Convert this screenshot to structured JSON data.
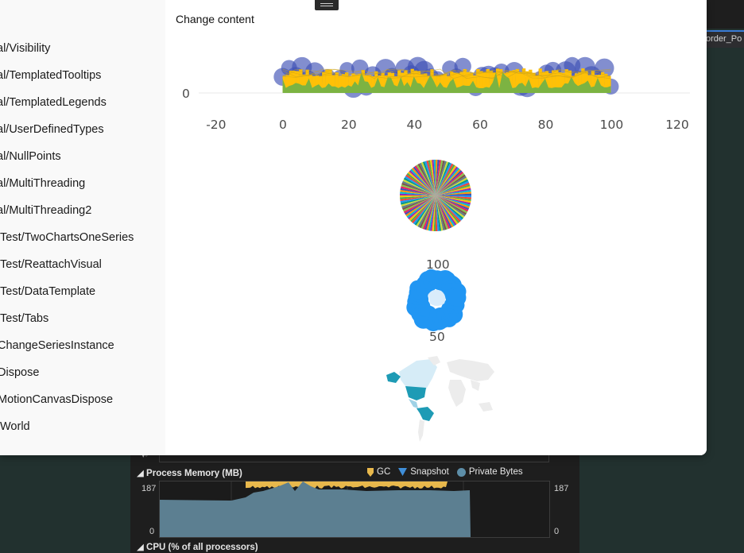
{
  "ide": {
    "tab_label": "order_Po"
  },
  "diagnostics": {
    "memory_heading": "Process Memory (MB)",
    "legend": {
      "gc": "GC",
      "snapshot": "Snapshot",
      "private_bytes": "Private Bytes"
    },
    "y_max_left": "187",
    "y_min_left": "0",
    "y_max_right": "187",
    "y_min_right": "0",
    "cpu_heading": "CPU (% of all processors)"
  },
  "app": {
    "change_content": "Change content",
    "nav_items": [
      "al/Visibility",
      "al/TemplatedTooltips",
      "al/TemplatedLegends",
      "al/UserDefinedTypes",
      "al/NullPoints",
      "al/MultiThreading",
      "al/MultiThreading2",
      "Test/TwoChartsOneSeries",
      "Test/ReattachVisual",
      "Test/DataTemplate",
      "Test/Tabs",
      "ChangeSeriesInstance",
      "Dispose",
      "MotionCanvasDispose",
      "World"
    ]
  },
  "chart_data": [
    {
      "type": "scatter",
      "x_ticks": [
        "-20",
        "0",
        "20",
        "40",
        "60",
        "80",
        "100",
        "120"
      ],
      "y_ticks": [
        "0"
      ],
      "xlim": [
        -20,
        120
      ]
    },
    {
      "type": "pie"
    },
    {
      "type": "polar",
      "radial_labels": [
        "100",
        "50"
      ]
    },
    {
      "type": "map"
    }
  ],
  "colors": {
    "scatter_blue": "#3f51b5",
    "column_yellow": "#ffc107",
    "area_green": "#7cb342",
    "polar_blue": "#2196f3",
    "map_teal": "#1e9bb5",
    "memory_fill": "#5c7f91",
    "gc_marker": "#e8b84c",
    "snapshot_marker": "#3f8ed8"
  }
}
